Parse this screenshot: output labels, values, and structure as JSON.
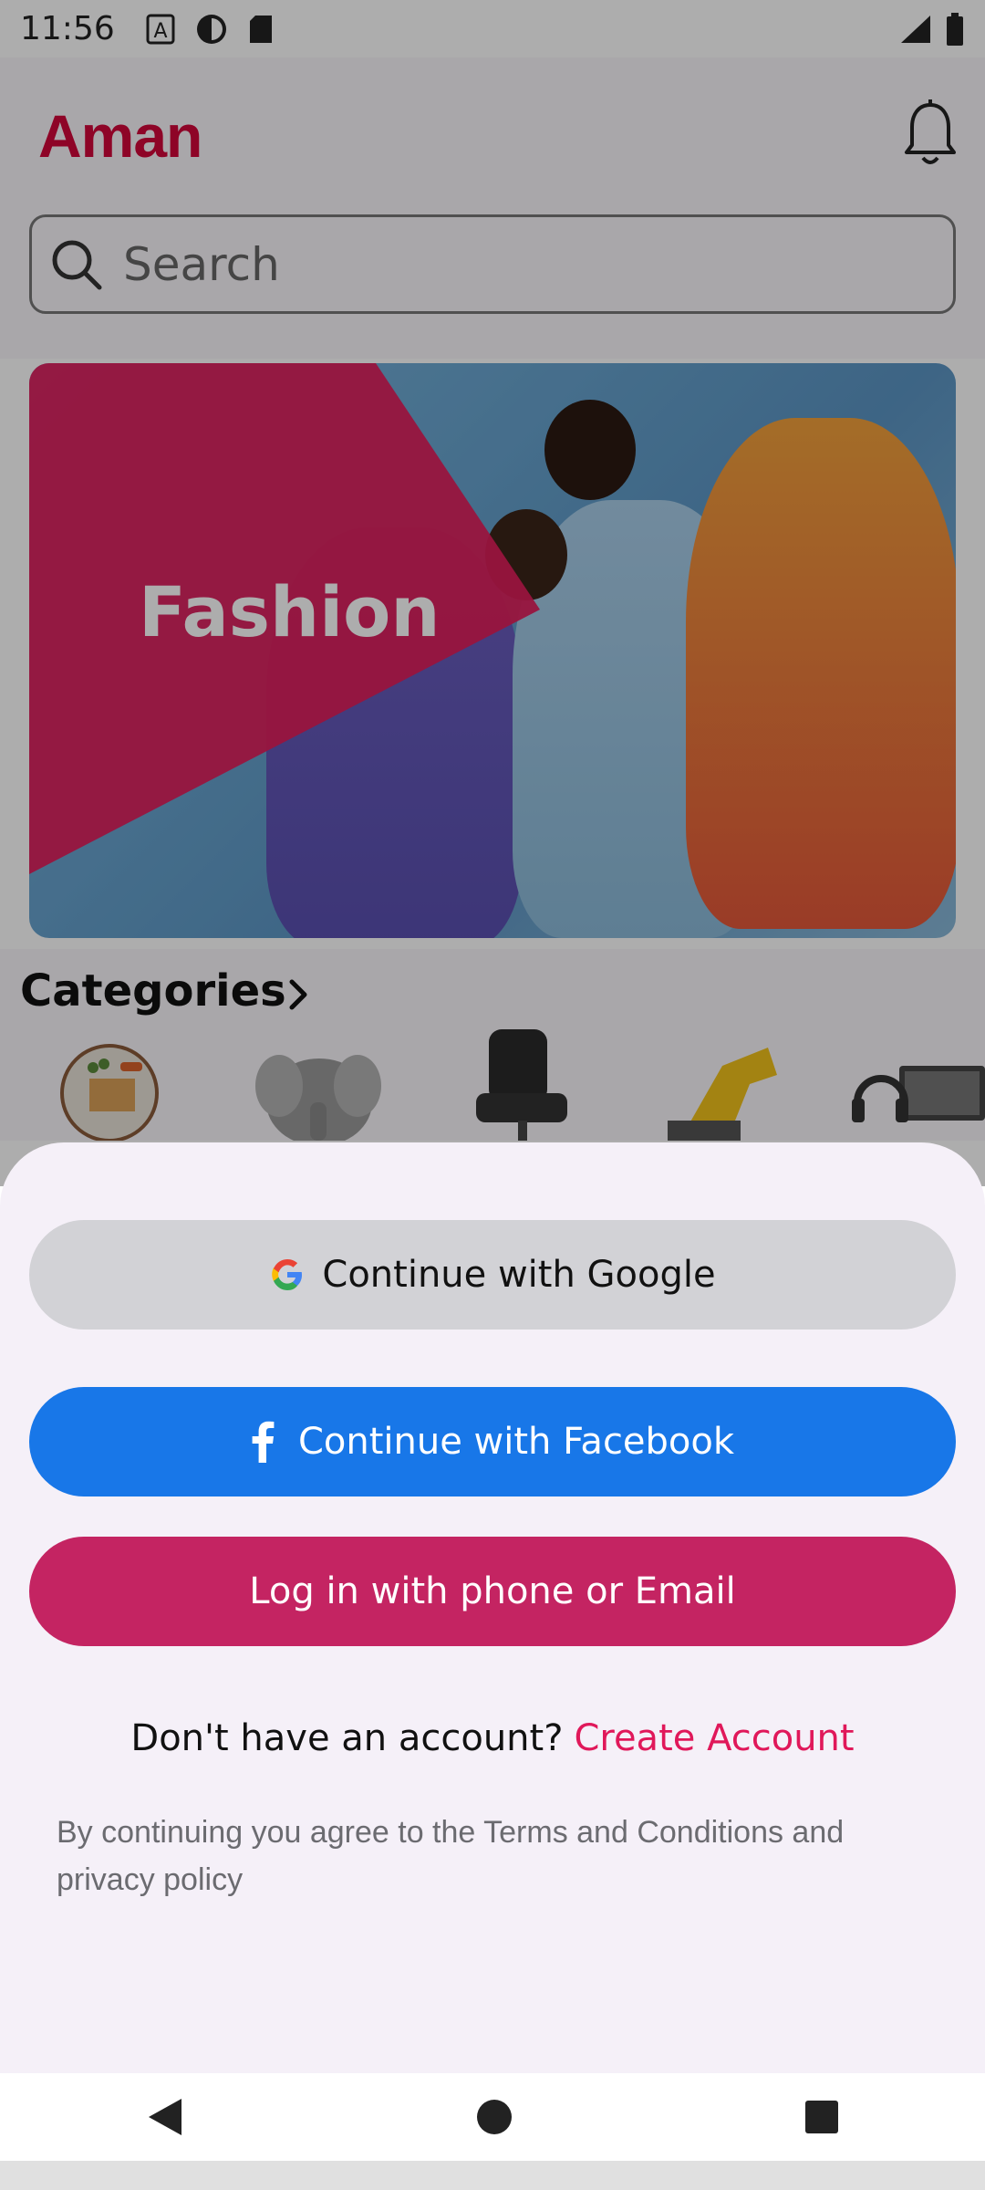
{
  "status_bar": {
    "time": "11:56"
  },
  "header": {
    "logo": "Aman"
  },
  "search": {
    "placeholder": "Search"
  },
  "banner": {
    "title": "Fashion"
  },
  "categories": {
    "title": "Categories"
  },
  "sheet": {
    "google_label": "Continue with Google",
    "facebook_label": "Continue with Facebook",
    "email_label": "Log in with phone or Email",
    "no_account_text": "Don't have an account?",
    "create_account_link": "Create Account",
    "terms_text": "By continuing you agree to the Terms and Conditions and privacy policy"
  },
  "colors": {
    "brand": "#d1063a",
    "facebook": "#1877e8",
    "email_button": "#c42462",
    "link": "#e0185a"
  },
  "icons": [
    "a-icon",
    "face-icon",
    "sd-card-icon",
    "signal-icon",
    "battery-icon",
    "bell-icon",
    "search-icon",
    "chevron-right-icon",
    "google-icon",
    "facebook-icon",
    "back-icon",
    "home-icon",
    "recents-icon"
  ]
}
